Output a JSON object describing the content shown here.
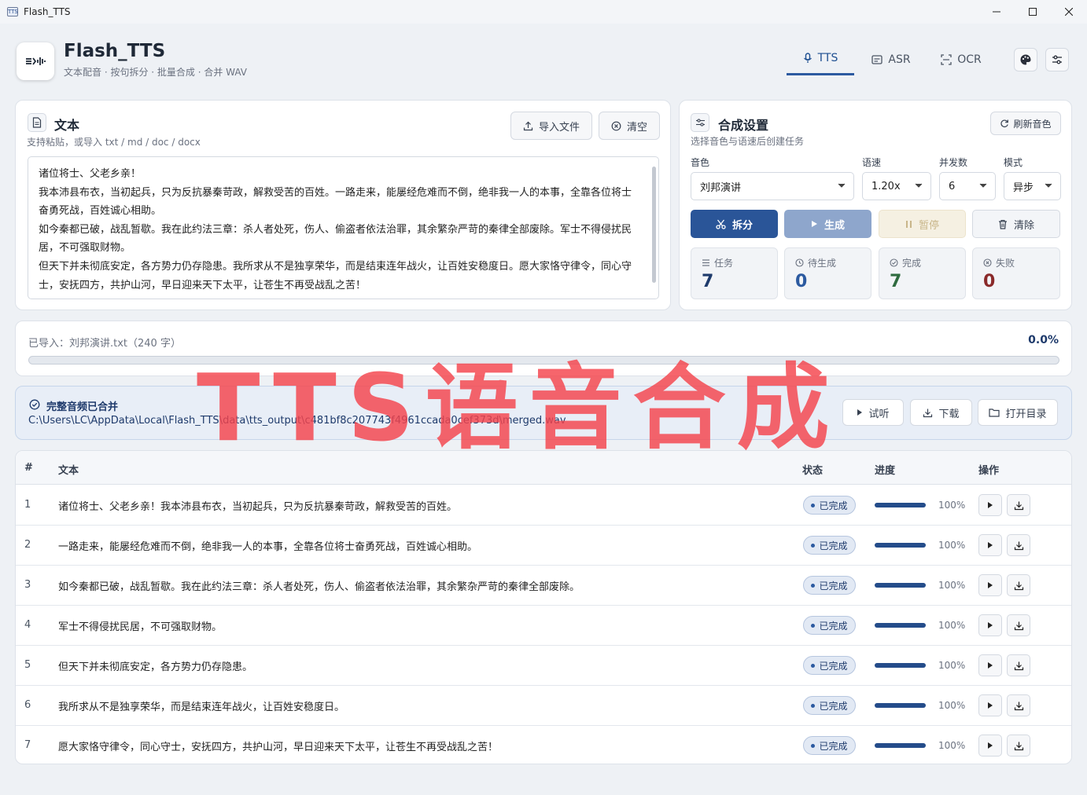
{
  "window": {
    "title": "Flash_TTS",
    "icon_text": "TTS"
  },
  "header": {
    "app_name": "Flash_TTS",
    "subtitle": "文本配音 · 按句拆分 · 批量合成 · 合并 WAV",
    "tabs": [
      {
        "label": "TTS",
        "icon": "microphone-icon",
        "active": true
      },
      {
        "label": "ASR",
        "icon": "caption-icon",
        "active": false
      },
      {
        "label": "OCR",
        "icon": "scan-icon",
        "active": false
      }
    ],
    "buttons": [
      {
        "icon": "palette-icon"
      },
      {
        "icon": "sliders-icon"
      }
    ]
  },
  "text_panel": {
    "title": "文本",
    "subtitle": "支持粘贴，或导入 txt / md / doc / docx",
    "import_label": "导入文件",
    "clear_label": "清空",
    "content": "诸位将士、父老乡亲！\n我本沛县布衣，当初起兵，只为反抗暴秦苛政，解救受苦的百姓。一路走来，能屡经危难而不倒，绝非我一人的本事，全靠各位将士奋勇死战，百姓诚心相助。\n如今秦都已破，战乱暂歇。我在此约法三章：杀人者处死，伤人、偷盗者依法治罪，其余繁杂严苛的秦律全部废除。军士不得侵扰民居，不可强取财物。\n但天下并未彻底安定，各方势力仍存隐患。我所求从不是独享荣华，而是结束连年战火，让百姓安稳度日。愿大家恪守律令，同心守士，安抚四方，共护山河，早日迎来天下太平，让苍生不再受战乱之苦！"
  },
  "settings": {
    "title": "合成设置",
    "subtitle": "选择音色与语速后创建任务",
    "refresh_label": "刷新音色",
    "voice_label": "音色",
    "voice_value": "刘邦演讲",
    "speed_label": "语速",
    "speed_value": "1.20x",
    "concurrency_label": "并发数",
    "concurrency_value": "6",
    "mode_label": "模式",
    "mode_value": "异步",
    "split_label": "拆分",
    "generate_label": "生成",
    "pause_label": "暂停",
    "clear_label": "清除",
    "stats": [
      {
        "label": "任务",
        "value": "7",
        "color": "#1e3a6b"
      },
      {
        "label": "待生成",
        "value": "0",
        "color": "#2c5aa0"
      },
      {
        "label": "完成",
        "value": "7",
        "color": "#2f6b3f"
      },
      {
        "label": "失败",
        "value": "0",
        "color": "#8a2a2a"
      }
    ]
  },
  "progress": {
    "label": "已导入：刘邦演讲.txt（240 字）",
    "percent_text": "0.0%",
    "fraction": 0.0
  },
  "merged": {
    "title": "完整音频已合并",
    "path": "C:\\Users\\LC\\AppData\\Local\\Flash_TTS\\data\\tts_output\\c481bf8c207743f4961ccada0cef373d\\merged.wav",
    "preview_label": "试听",
    "download_label": "下载",
    "open_dir_label": "打开目录"
  },
  "table": {
    "headers": {
      "index": "#",
      "text": "文本",
      "status": "状态",
      "progress": "进度",
      "actions": "操作"
    },
    "rows": [
      {
        "index": "1",
        "text": "诸位将士、父老乡亲！我本沛县布衣，当初起兵，只为反抗暴秦苛政，解救受苦的百姓。",
        "status": "已完成",
        "progress": 1.0,
        "progress_text": "100%"
      },
      {
        "index": "2",
        "text": "一路走来，能屡经危难而不倒，绝非我一人的本事，全靠各位将士奋勇死战，百姓诚心相助。",
        "status": "已完成",
        "progress": 1.0,
        "progress_text": "100%"
      },
      {
        "index": "3",
        "text": "如今秦都已破，战乱暂歇。我在此约法三章：杀人者处死，伤人、偷盗者依法治罪，其余繁杂严苛的秦律全部废除。",
        "status": "已完成",
        "progress": 1.0,
        "progress_text": "100%"
      },
      {
        "index": "4",
        "text": "军士不得侵扰民居，不可强取财物。",
        "status": "已完成",
        "progress": 1.0,
        "progress_text": "100%"
      },
      {
        "index": "5",
        "text": "但天下并未彻底安定，各方势力仍存隐患。",
        "status": "已完成",
        "progress": 1.0,
        "progress_text": "100%"
      },
      {
        "index": "6",
        "text": "我所求从不是独享荣华，而是结束连年战火，让百姓安稳度日。",
        "status": "已完成",
        "progress": 1.0,
        "progress_text": "100%"
      },
      {
        "index": "7",
        "text": "愿大家恪守律令，同心守士，安抚四方，共护山河，早日迎来天下太平，让苍生不再受战乱之苦！",
        "status": "已完成",
        "progress": 1.0,
        "progress_text": "100%"
      }
    ]
  },
  "watermark": "TTS语音合成",
  "colors": {
    "accent": "#2c5aa0",
    "accent_dark": "#244c8a",
    "generate_disabled": "#8ea6cc",
    "pause_disabled_bg": "#f5f0e2",
    "watermark": "#f4434c"
  }
}
